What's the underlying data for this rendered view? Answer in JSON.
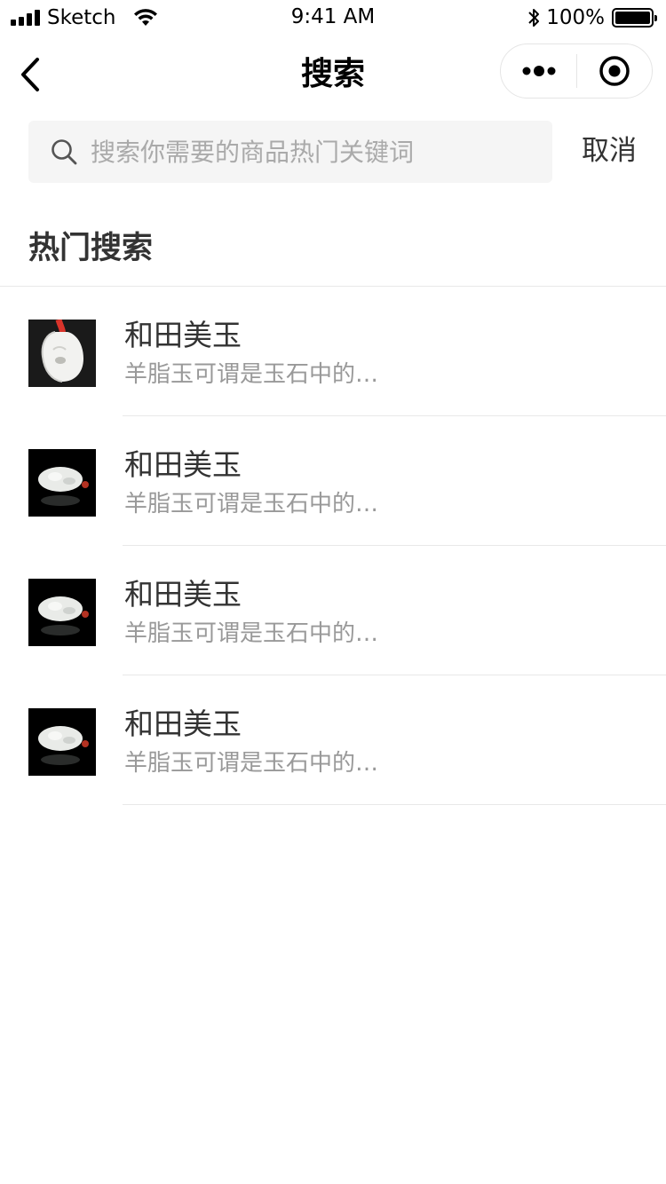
{
  "status_bar": {
    "carrier": "Sketch",
    "time": "9:41 AM",
    "battery": "100%"
  },
  "nav": {
    "title": "搜索",
    "back_icon": "chevron-left-icon",
    "more_icon": "more-dots-icon",
    "close_icon": "target-circle-icon"
  },
  "search": {
    "placeholder": "搜索你需要的商品热门关键词",
    "value": "",
    "cancel_label": "取消"
  },
  "hot_search": {
    "title": "热门搜索",
    "items": [
      {
        "title": "和田美玉",
        "desc": "羊脂玉可谓是玉石中的…"
      },
      {
        "title": "和田美玉",
        "desc": "羊脂玉可谓是玉石中的…"
      },
      {
        "title": "和田美玉",
        "desc": "羊脂玉可谓是玉石中的…"
      },
      {
        "title": "和田美玉",
        "desc": "羊脂玉可谓是玉石中的…"
      }
    ]
  },
  "colors": {
    "text_primary": "#333333",
    "text_secondary": "#999999",
    "placeholder": "#aaaaaa",
    "search_bg": "#f5f5f5",
    "divider": "#e8e8e8"
  }
}
